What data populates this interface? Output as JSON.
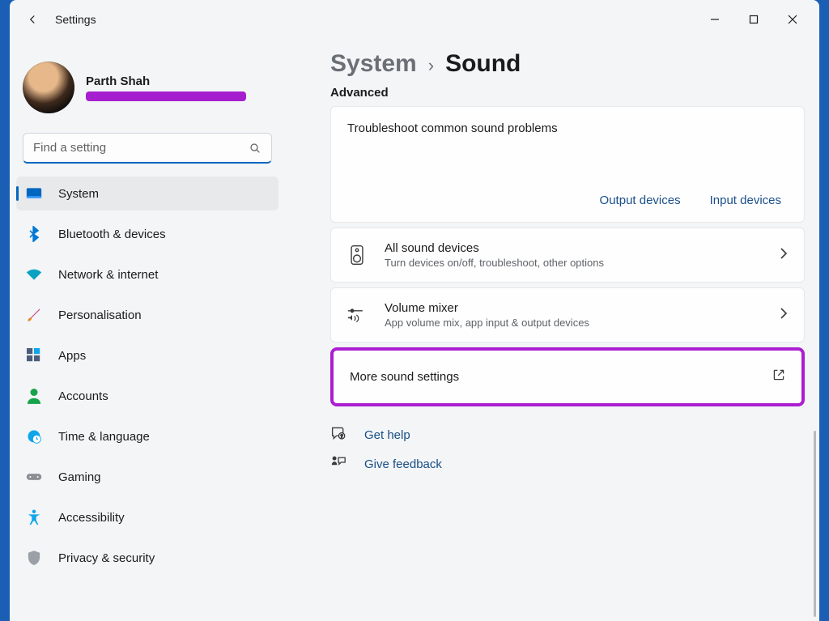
{
  "window": {
    "title": "Settings"
  },
  "profile": {
    "name": "Parth Shah"
  },
  "search": {
    "placeholder": "Find a setting"
  },
  "nav": {
    "items": [
      {
        "label": "System"
      },
      {
        "label": "Bluetooth & devices"
      },
      {
        "label": "Network & internet"
      },
      {
        "label": "Personalisation"
      },
      {
        "label": "Apps"
      },
      {
        "label": "Accounts"
      },
      {
        "label": "Time & language"
      },
      {
        "label": "Gaming"
      },
      {
        "label": "Accessibility"
      },
      {
        "label": "Privacy & security"
      }
    ]
  },
  "breadcrumb": {
    "parent": "System",
    "current": "Sound"
  },
  "section": "Advanced",
  "troubleshoot": {
    "title": "Troubleshoot common sound problems",
    "output": "Output devices",
    "input": "Input devices"
  },
  "rows": {
    "all_devices": {
      "title": "All sound devices",
      "sub": "Turn devices on/off, troubleshoot, other options"
    },
    "mixer": {
      "title": "Volume mixer",
      "sub": "App volume mix, app input & output devices"
    },
    "more": {
      "title": "More sound settings"
    }
  },
  "footlinks": {
    "help": "Get help",
    "feedback": "Give feedback"
  }
}
